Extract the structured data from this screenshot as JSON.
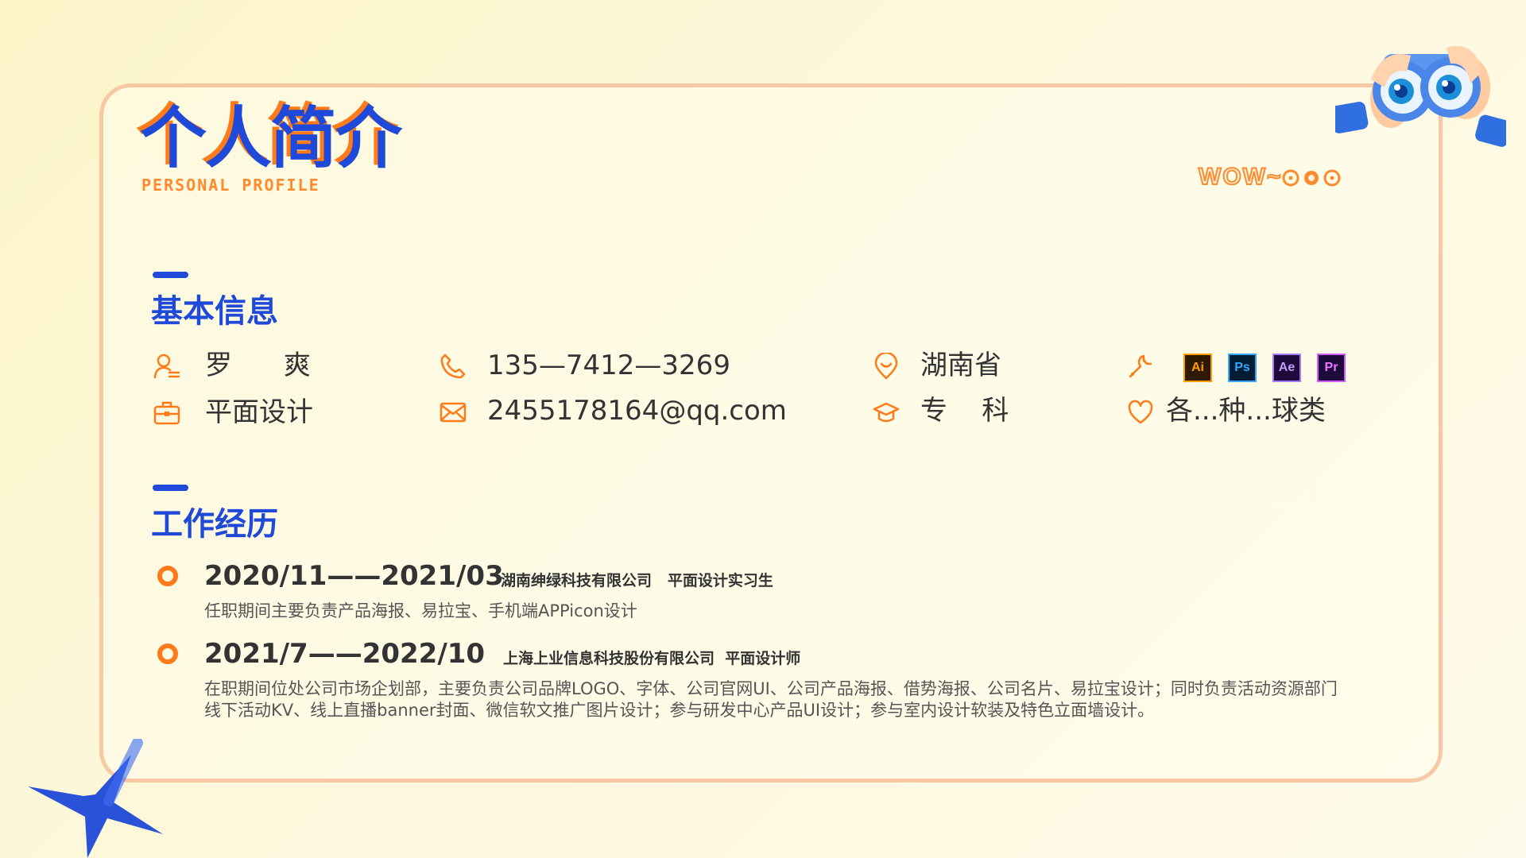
{
  "header": {
    "title_cn": "个人简介",
    "title_en": "PERSONAL PROFILE",
    "wow": "WOW~"
  },
  "colors": {
    "primary_blue": "#1f49d9",
    "accent_orange": "#ff7a18",
    "card_border": "#f8c7a4"
  },
  "basic_info": {
    "heading": "基本信息",
    "name": "罗      爽",
    "occupation": "平面设计",
    "phone": "135—7412—3269",
    "email": "2455178164@qq.com",
    "location": "湖南省",
    "education": "专    科",
    "hobby": "各...种...球类",
    "software": [
      {
        "label": "Ai",
        "bg": "#2d1a00",
        "fg": "#ff9a00"
      },
      {
        "label": "Ps",
        "bg": "#001d34",
        "fg": "#31a8ff"
      },
      {
        "label": "Ae",
        "bg": "#1e0b3c",
        "fg": "#c39bff"
      },
      {
        "label": "Pr",
        "bg": "#1e0b3c",
        "fg": "#ea77ff"
      }
    ],
    "icons": [
      "user-icon",
      "briefcase-icon",
      "phone-icon",
      "mail-icon",
      "location-icon",
      "graduation-cap-icon",
      "wrench-icon",
      "heart-icon"
    ]
  },
  "work": {
    "heading": "工作经历",
    "jobs": [
      {
        "period": "2020/11——2021/03",
        "company": "湖南绅绿科技有限公司   平面设计实习生",
        "desc": "任职期间主要负责产品海报、易拉宝、手机端APPicon设计"
      },
      {
        "period": "2021/7——2022/10",
        "company": "上海上业信息科技股份有限公司  平面设计师",
        "desc": "在职期间位处公司市场企划部，主要负责公司品牌LOGO、字体、公司官网UI、公司产品海报、借势海报、公司名片、易拉宝设计；同时负责活动资源部门线下活动KV、线上直播banner封面、微信软文推广图片设计；参与研发中心产品UI设计；参与室内设计软装及特色立面墙设计。"
      }
    ]
  }
}
